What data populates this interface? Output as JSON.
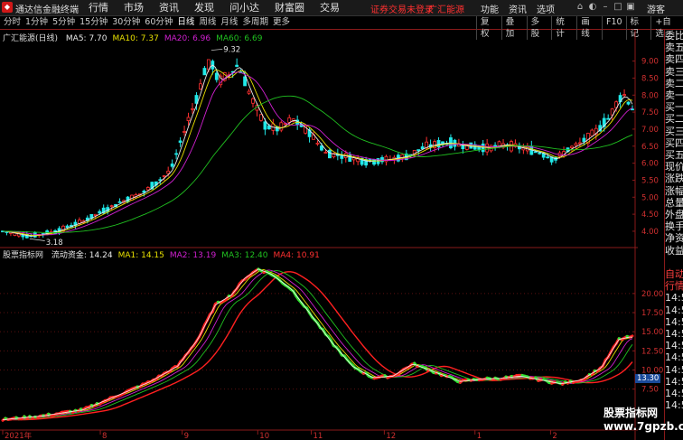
{
  "title_bar": {
    "app_title": "通达信金融终端",
    "menu": [
      "行情",
      "市场",
      "资讯",
      "发现",
      "问小达",
      "财富圈",
      "交易"
    ],
    "notice": "证券交易未登录",
    "notice2": "广汇能源",
    "right_menu": [
      "功能",
      "资讯",
      "选项"
    ],
    "guest_label": "游客"
  },
  "toolbar": {
    "periods": [
      "分时",
      "1分钟",
      "5分钟",
      "15分钟",
      "30分钟",
      "60分钟",
      "日线",
      "周线",
      "月线",
      "多周期",
      "更多"
    ],
    "active_period": "日线",
    "right_tools": [
      "复权",
      "叠加",
      "多股",
      "统计",
      "画线",
      "F10",
      "标记",
      "+自选"
    ]
  },
  "main_chart": {
    "stock_label": "广汇能源(日线)",
    "ma_legend": [
      {
        "label": "MA5: 7.70",
        "color": "#e8e8e8"
      },
      {
        "label": "MA10: 7.37",
        "color": "#e8e000"
      },
      {
        "label": "MA20: 6.96",
        "color": "#d020d0"
      },
      {
        "label": "MA60: 6.69",
        "color": "#20c020"
      }
    ],
    "high_label": "9.32",
    "low_label": "3.18",
    "y_ticks": [
      "9.00",
      "8.50",
      "8.00",
      "7.50",
      "7.00",
      "6.50",
      "6.00",
      "5.50",
      "5.00",
      "4.50",
      "4.00"
    ]
  },
  "indicator": {
    "name": "股票指标网",
    "legend": [
      {
        "label": "流动资金: 14.24",
        "color": "#e8e8e8"
      },
      {
        "label": "MA1: 14.15",
        "color": "#e8e000"
      },
      {
        "label": "MA2: 13.19",
        "color": "#d020d0"
      },
      {
        "label": "MA3: 12.40",
        "color": "#20c020"
      },
      {
        "label": "MA4: 10.91",
        "color": "#ff3030"
      }
    ],
    "y_ticks": [
      "20.00",
      "17.50",
      "15.00",
      "12.50",
      "10.00",
      "7.50"
    ],
    "current_tag": "13.30"
  },
  "x_axis": {
    "labels": [
      {
        "label": "2021年",
        "pos": 0.0
      },
      {
        "label": "8",
        "pos": 0.155
      },
      {
        "label": "9",
        "pos": 0.285
      },
      {
        "label": "10",
        "pos": 0.405
      },
      {
        "label": "11",
        "pos": 0.49
      },
      {
        "label": "12",
        "pos": 0.606
      },
      {
        "label": "1",
        "pos": 0.75
      },
      {
        "label": "2",
        "pos": 0.87
      }
    ]
  },
  "right_panel": {
    "items": [
      "委比",
      "卖五",
      "卖四",
      "卖三",
      "卖二",
      "卖一",
      "买一",
      "买二",
      "买三",
      "买四",
      "买五",
      "现价",
      "涨跌",
      "涨幅",
      "总量",
      "外盘",
      "换手",
      "净资",
      "收益",
      "",
      "自动",
      "行情",
      "14:5",
      "14:5",
      "14:5",
      "14:5",
      "14:5",
      "14:5",
      "14:5",
      "14:5",
      "14:5",
      "14:5"
    ]
  },
  "watermark": {
    "line1": "股票指标网",
    "line2": "www.7gpzb.com"
  },
  "colors": {
    "up": "#ff3030",
    "down": "#20e8e8",
    "ma5": "#e8e8e8",
    "ma10": "#e8e000",
    "ma20": "#d020d0",
    "ma60": "#20c020",
    "grid_red": "#8a1a1a"
  },
  "chart_data": {
    "type": "candlestick",
    "price_anchors": [
      [
        0,
        4.0
      ],
      [
        20,
        3.85
      ],
      [
        40,
        4.0
      ],
      [
        60,
        4.3
      ],
      [
        75,
        4.6
      ],
      [
        90,
        4.9
      ],
      [
        105,
        5.15
      ],
      [
        115,
        5.45
      ],
      [
        125,
        5.8
      ],
      [
        132,
        6.6
      ],
      [
        138,
        7.3
      ],
      [
        145,
        8.0
      ],
      [
        150,
        8.7
      ],
      [
        155,
        9.0
      ],
      [
        160,
        8.4
      ],
      [
        168,
        8.6
      ],
      [
        175,
        8.9
      ],
      [
        185,
        7.9
      ],
      [
        195,
        7.1
      ],
      [
        205,
        7.0
      ],
      [
        215,
        7.3
      ],
      [
        228,
        6.9
      ],
      [
        240,
        6.3
      ],
      [
        255,
        6.2
      ],
      [
        270,
        6.05
      ],
      [
        285,
        6.1
      ],
      [
        300,
        6.2
      ],
      [
        315,
        6.5
      ],
      [
        330,
        6.6
      ],
      [
        345,
        6.5
      ],
      [
        360,
        6.45
      ],
      [
        375,
        6.55
      ],
      [
        390,
        6.4
      ],
      [
        400,
        6.3
      ],
      [
        410,
        6.1
      ],
      [
        420,
        6.4
      ],
      [
        430,
        6.6
      ],
      [
        440,
        6.9
      ],
      [
        450,
        7.3
      ],
      [
        458,
        7.9
      ],
      [
        462,
        8.0
      ],
      [
        468,
        7.6
      ]
    ],
    "indicator_anchors": [
      [
        0,
        3.5
      ],
      [
        30,
        4.0
      ],
      [
        60,
        4.8
      ],
      [
        90,
        7.0
      ],
      [
        110,
        8.5
      ],
      [
        130,
        10.5
      ],
      [
        145,
        14.0
      ],
      [
        158,
        18.5
      ],
      [
        170,
        19.8
      ],
      [
        180,
        22.0
      ],
      [
        190,
        23.2
      ],
      [
        200,
        22.5
      ],
      [
        215,
        20.5
      ],
      [
        230,
        17.0
      ],
      [
        245,
        13.5
      ],
      [
        260,
        10.5
      ],
      [
        275,
        9.0
      ],
      [
        290,
        9.2
      ],
      [
        305,
        10.8
      ],
      [
        320,
        9.8
      ],
      [
        340,
        8.5
      ],
      [
        355,
        8.8
      ],
      [
        370,
        8.9
      ],
      [
        385,
        9.2
      ],
      [
        400,
        8.7
      ],
      [
        415,
        8.2
      ],
      [
        430,
        8.7
      ],
      [
        445,
        10.3
      ],
      [
        458,
        14.0
      ],
      [
        466,
        14.3
      ]
    ],
    "price_range": [
      3.6,
      9.6
    ],
    "indicator_range": [
      2.5,
      24.0
    ]
  }
}
